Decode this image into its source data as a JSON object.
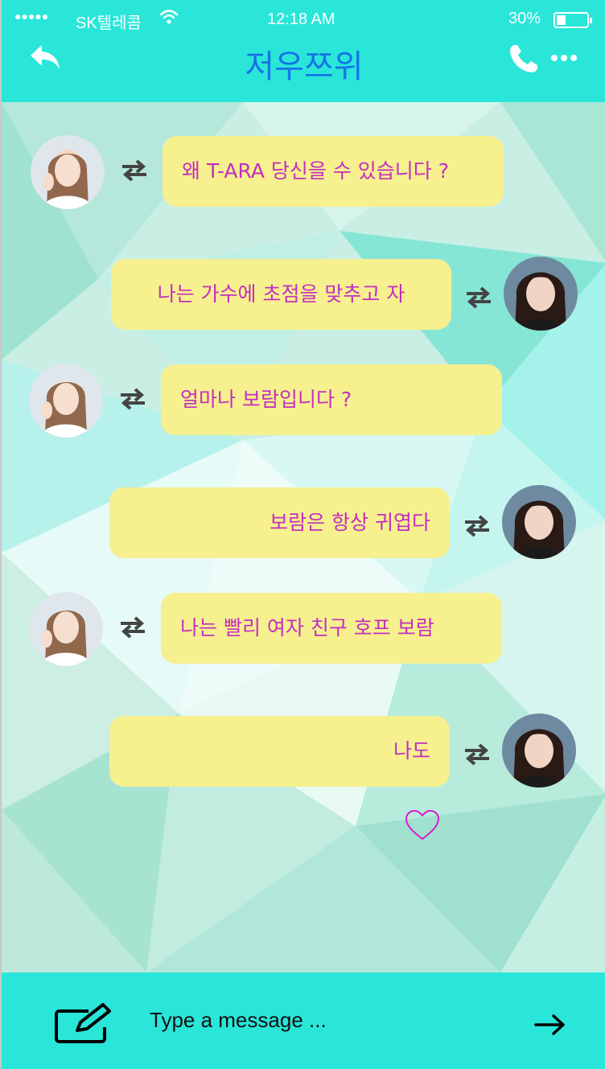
{
  "status_bar": {
    "signal": "●●●●●",
    "carrier": "SK텔레콤",
    "time": "12:18 AM",
    "battery": "30%",
    "battery_level": 0.3
  },
  "header": {
    "title": "저우쯔위",
    "back_icon": "reply-arrow-icon",
    "call_icon": "phone-icon",
    "more_icon": "more-dots-icon"
  },
  "colors": {
    "header_bg": "#29e6d9",
    "title": "#1673e8",
    "bubble_bg": "#f6f08e",
    "bubble_text": "#c42ec0",
    "heart": "#d81bd0"
  },
  "messages": [
    {
      "sender": "left",
      "text": "왜 T-ARA 당신을 수 있습니다 ?"
    },
    {
      "sender": "right",
      "text": "나는 가수에 초점을 맞추고 자"
    },
    {
      "sender": "left",
      "text": "얼마나 보람입니다 ?"
    },
    {
      "sender": "right",
      "text": "보람은 항상 귀엽다"
    },
    {
      "sender": "left",
      "text": "나는 빨리 여자 친구 호프 보람"
    },
    {
      "sender": "right",
      "text": "나도"
    }
  ],
  "reaction_icon": "heart-outline-icon",
  "footer": {
    "placeholder": "Type a message ...",
    "compose_icon": "compose-icon",
    "send_icon": "arrow-right-icon"
  }
}
